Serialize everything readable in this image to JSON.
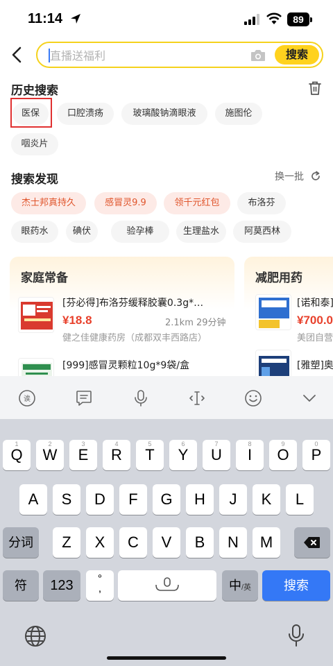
{
  "status": {
    "time": "11:14",
    "battery": "89"
  },
  "search": {
    "placeholder": "直播送福利",
    "button": "搜索"
  },
  "history": {
    "title": "历史搜索",
    "items": [
      "医保",
      "口腔溃疡",
      "玻璃酸钠滴眼液",
      "施图伦",
      "咽炎片"
    ]
  },
  "discover": {
    "title": "搜索发现",
    "refresh": "换一批",
    "items": [
      "杰士邦真持久",
      "感冒灵9.9",
      "领千元红包",
      "布洛芬",
      "眼药水",
      "碘伏",
      "验孕棒",
      "生理盐水",
      "阿莫西林"
    ]
  },
  "cards": [
    {
      "title": "家庭常备",
      "products": [
        {
          "name": "[芬必得]布洛芬缓释胶囊0.3g*…",
          "price": "¥18.8",
          "distance": "2.1km 29分钟",
          "shop": "健之佳健康药房（成都双丰西路店）"
        },
        {
          "name": "[999]感冒灵颗粒10g*9袋/盒"
        }
      ]
    },
    {
      "title": "减肥用药",
      "products": [
        {
          "name": "[诺和泰]",
          "price": "¥700.0",
          "shop": "美团自营"
        },
        {
          "name": "[雅塑]奥"
        }
      ]
    }
  ],
  "keyboard": {
    "row1": [
      [
        "Q",
        "1"
      ],
      [
        "W",
        "2"
      ],
      [
        "E",
        "3"
      ],
      [
        "R",
        "4"
      ],
      [
        "T",
        "5"
      ],
      [
        "Y",
        "6"
      ],
      [
        "U",
        "7"
      ],
      [
        "I",
        "8"
      ],
      [
        "O",
        "9"
      ],
      [
        "P",
        "0"
      ]
    ],
    "row2": [
      "A",
      "S",
      "D",
      "F",
      "G",
      "H",
      "J",
      "K",
      "L"
    ],
    "row3": [
      "Z",
      "X",
      "C",
      "V",
      "B",
      "N",
      "M"
    ],
    "fenci": "分词",
    "fu": "符",
    "num": "123",
    "punct": "°\n,",
    "lang_main": "中",
    "lang_sub": "/英",
    "search": "搜索"
  },
  "colors": {
    "accent": "#ffd21e",
    "price": "#e8412c",
    "hot_chip_bg": "#fdeae6",
    "hot_chip_text": "#e0552c",
    "kb_blue": "#3478f6",
    "selection_box": "#e03030"
  }
}
